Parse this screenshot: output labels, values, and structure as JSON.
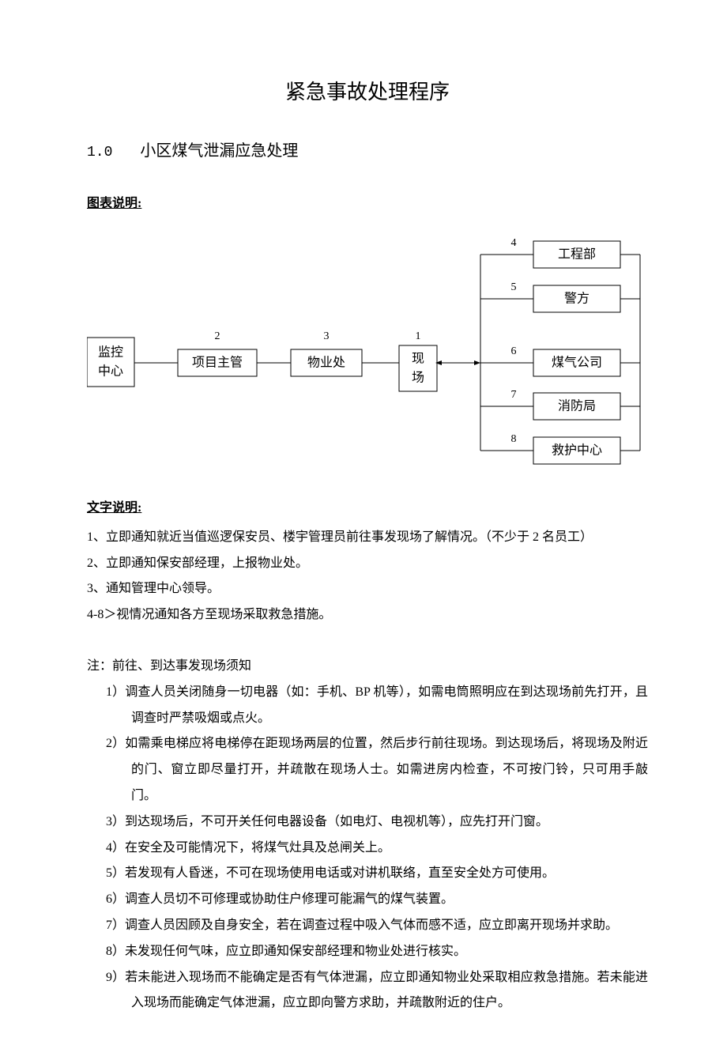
{
  "title": "紧急事故处理程序",
  "section": {
    "num": "1.0",
    "heading": "小区煤气泄漏应急处理"
  },
  "labels": {
    "diagram": "图表说明:",
    "text": "文字说明:"
  },
  "diagram": {
    "left": "监控中心",
    "node2": "项目主管",
    "node3": "物业处",
    "node1": "现场",
    "right": {
      "n4": "工程部",
      "n5": "警方",
      "n6": "煤气公司",
      "n7": "消防局",
      "n8": "救护中心"
    },
    "nums": {
      "n1": "1",
      "n2": "2",
      "n3": "3",
      "n4": "4",
      "n5": "5",
      "n6": "6",
      "n7": "7",
      "n8": "8"
    }
  },
  "desc": {
    "l1": "1、立即通知就近当值巡逻保安员、楼宇管理员前往事发现场了解情况。（不少于 2 名员工）",
    "l2": "2、立即通知保安部经理，上报物业处。",
    "l3": "3、通知管理中心领导。",
    "l4": "4-8＞视情况通知各方至现场采取救急措施。"
  },
  "notes": {
    "head": "注：前往、到达事发现场须知",
    "i1": "1）调查人员关闭随身一切电器（如：手机、BP 机等），如需电筒照明应在到达现场前先打开，且调查时严禁吸烟或点火。",
    "i2": "2）如需乘电梯应将电梯停在距现场两层的位置，然后步行前往现场。到达现场后，将现场及附近的门、窗立即尽量打开，并疏散在现场人士。如需进房内检查，不可按门铃，只可用手敲门。",
    "i3": "3）到达现场后，不可开关任何电器设备（如电灯、电视机等），应先打开门窗。",
    "i4": "4）在安全及可能情况下，将煤气灶具及总闸关上。",
    "i5": "5）若发现有人昏迷，不可在现场使用电话或对讲机联络，直至安全处方可使用。",
    "i6": "6）调查人员切不可修理或协助住户修理可能漏气的煤气装置。",
    "i7": "7）调查人员因顾及自身安全，若在调查过程中吸入气体而感不适，应立即离开现场并求助。",
    "i8": "8）未发现任何气味，应立即通知保安部经理和物业处进行核实。",
    "i9": "9）若未能进入现场而不能确定是否有气体泄漏，应立即通知物业处采取相应救急措施。若未能进入现场而能确定气体泄漏，应立即向警方求助，并疏散附近的住户。"
  }
}
